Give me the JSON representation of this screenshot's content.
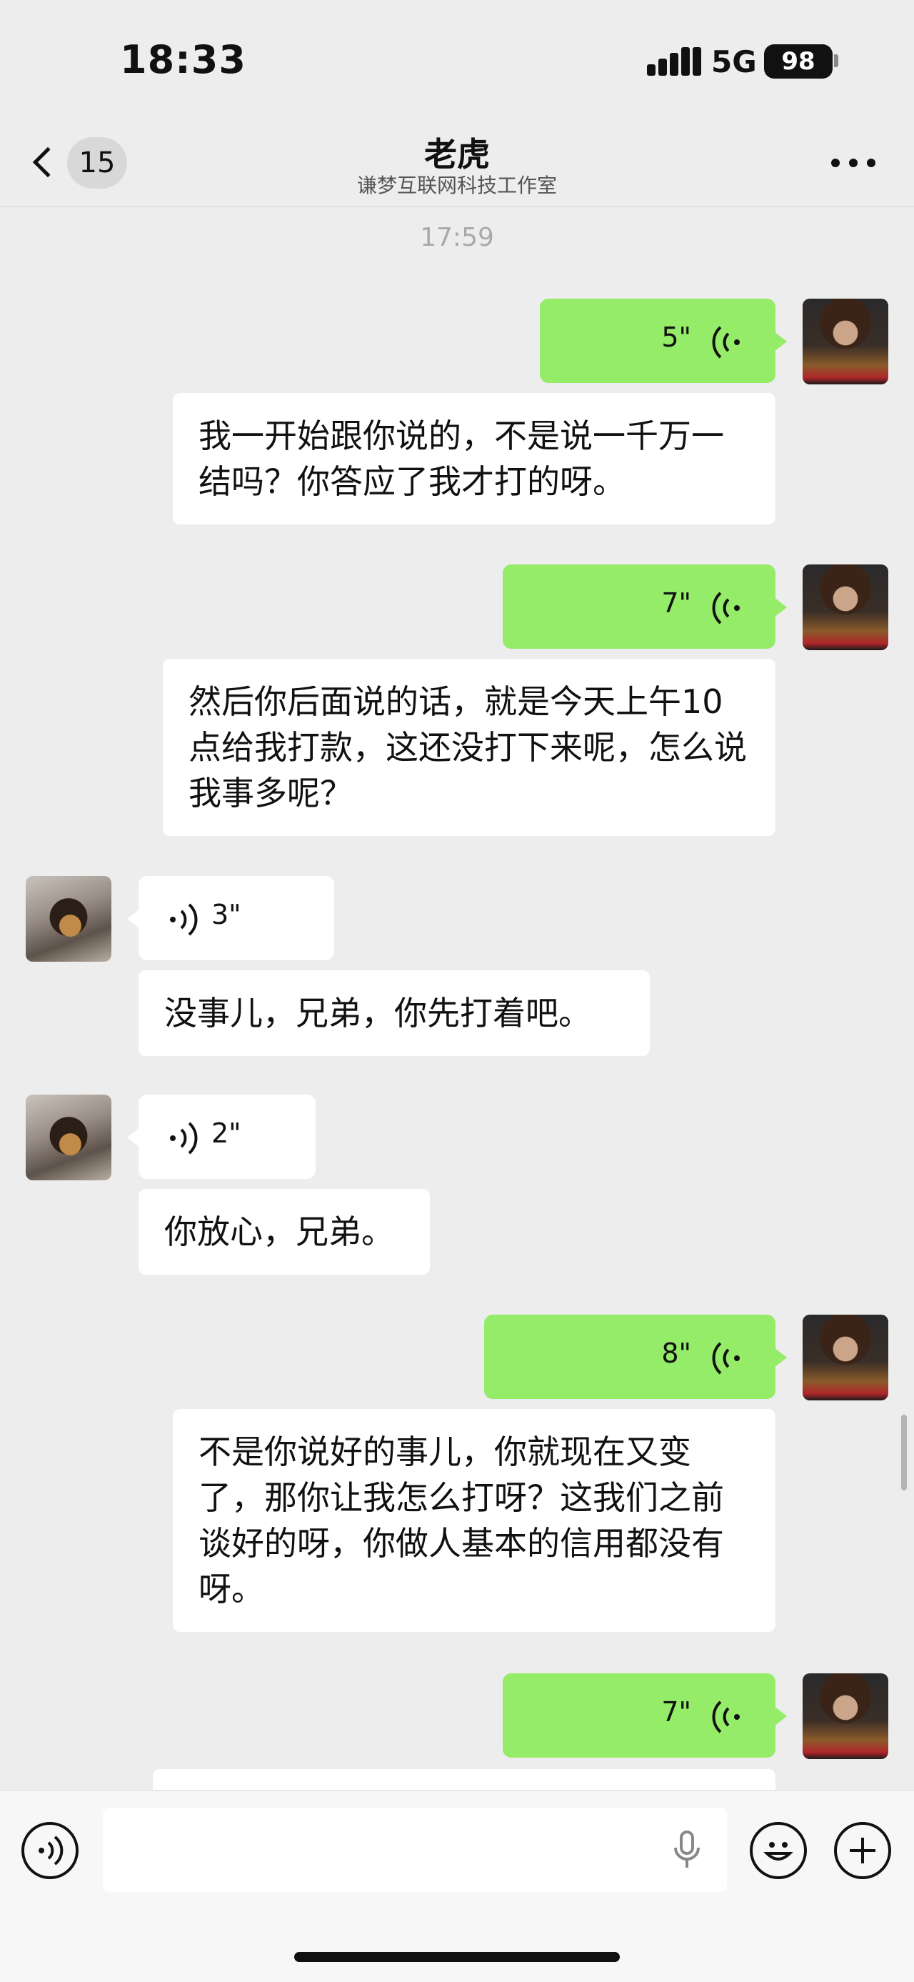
{
  "status_bar": {
    "time": "18:33",
    "network": "5G",
    "battery": "98"
  },
  "header": {
    "unread_count": "15",
    "title": "老虎",
    "subtitle": "谦梦互联网科技工作室"
  },
  "timestamp": "17:59",
  "messages": [
    {
      "from": "me",
      "type": "voice",
      "duration": "5\"",
      "transcript": "我一开始跟你说的，不是说一千万一结吗？你答应了我才打的呀。"
    },
    {
      "from": "me",
      "type": "voice",
      "duration": "7\"",
      "transcript": "然后你后面说的话，就是今天上午10点给我打款，这还没打下来呢，怎么说我事多呢？"
    },
    {
      "from": "other",
      "type": "voice",
      "duration": "3\"",
      "transcript": "没事儿，兄弟，你先打着吧。"
    },
    {
      "from": "other",
      "type": "voice",
      "duration": "2\"",
      "transcript": "你放心，兄弟。"
    },
    {
      "from": "me",
      "type": "voice",
      "duration": "8\"",
      "transcript": "不是你说好的事儿，你就现在又变了，那你让我怎么打呀？这我们之前谈好的呀，你做人基本的信用都没有呀。"
    },
    {
      "from": "me",
      "type": "voice",
      "duration": "7\""
    }
  ],
  "icons": [
    "back-chevron-icon",
    "more-icon",
    "voice-wave-icon",
    "voice-input-icon",
    "microphone-icon",
    "emoji-icon",
    "plus-icon"
  ],
  "colors": {
    "background": "#ededed",
    "my_bubble": "#95ec69",
    "other_bubble": "#ffffff"
  }
}
